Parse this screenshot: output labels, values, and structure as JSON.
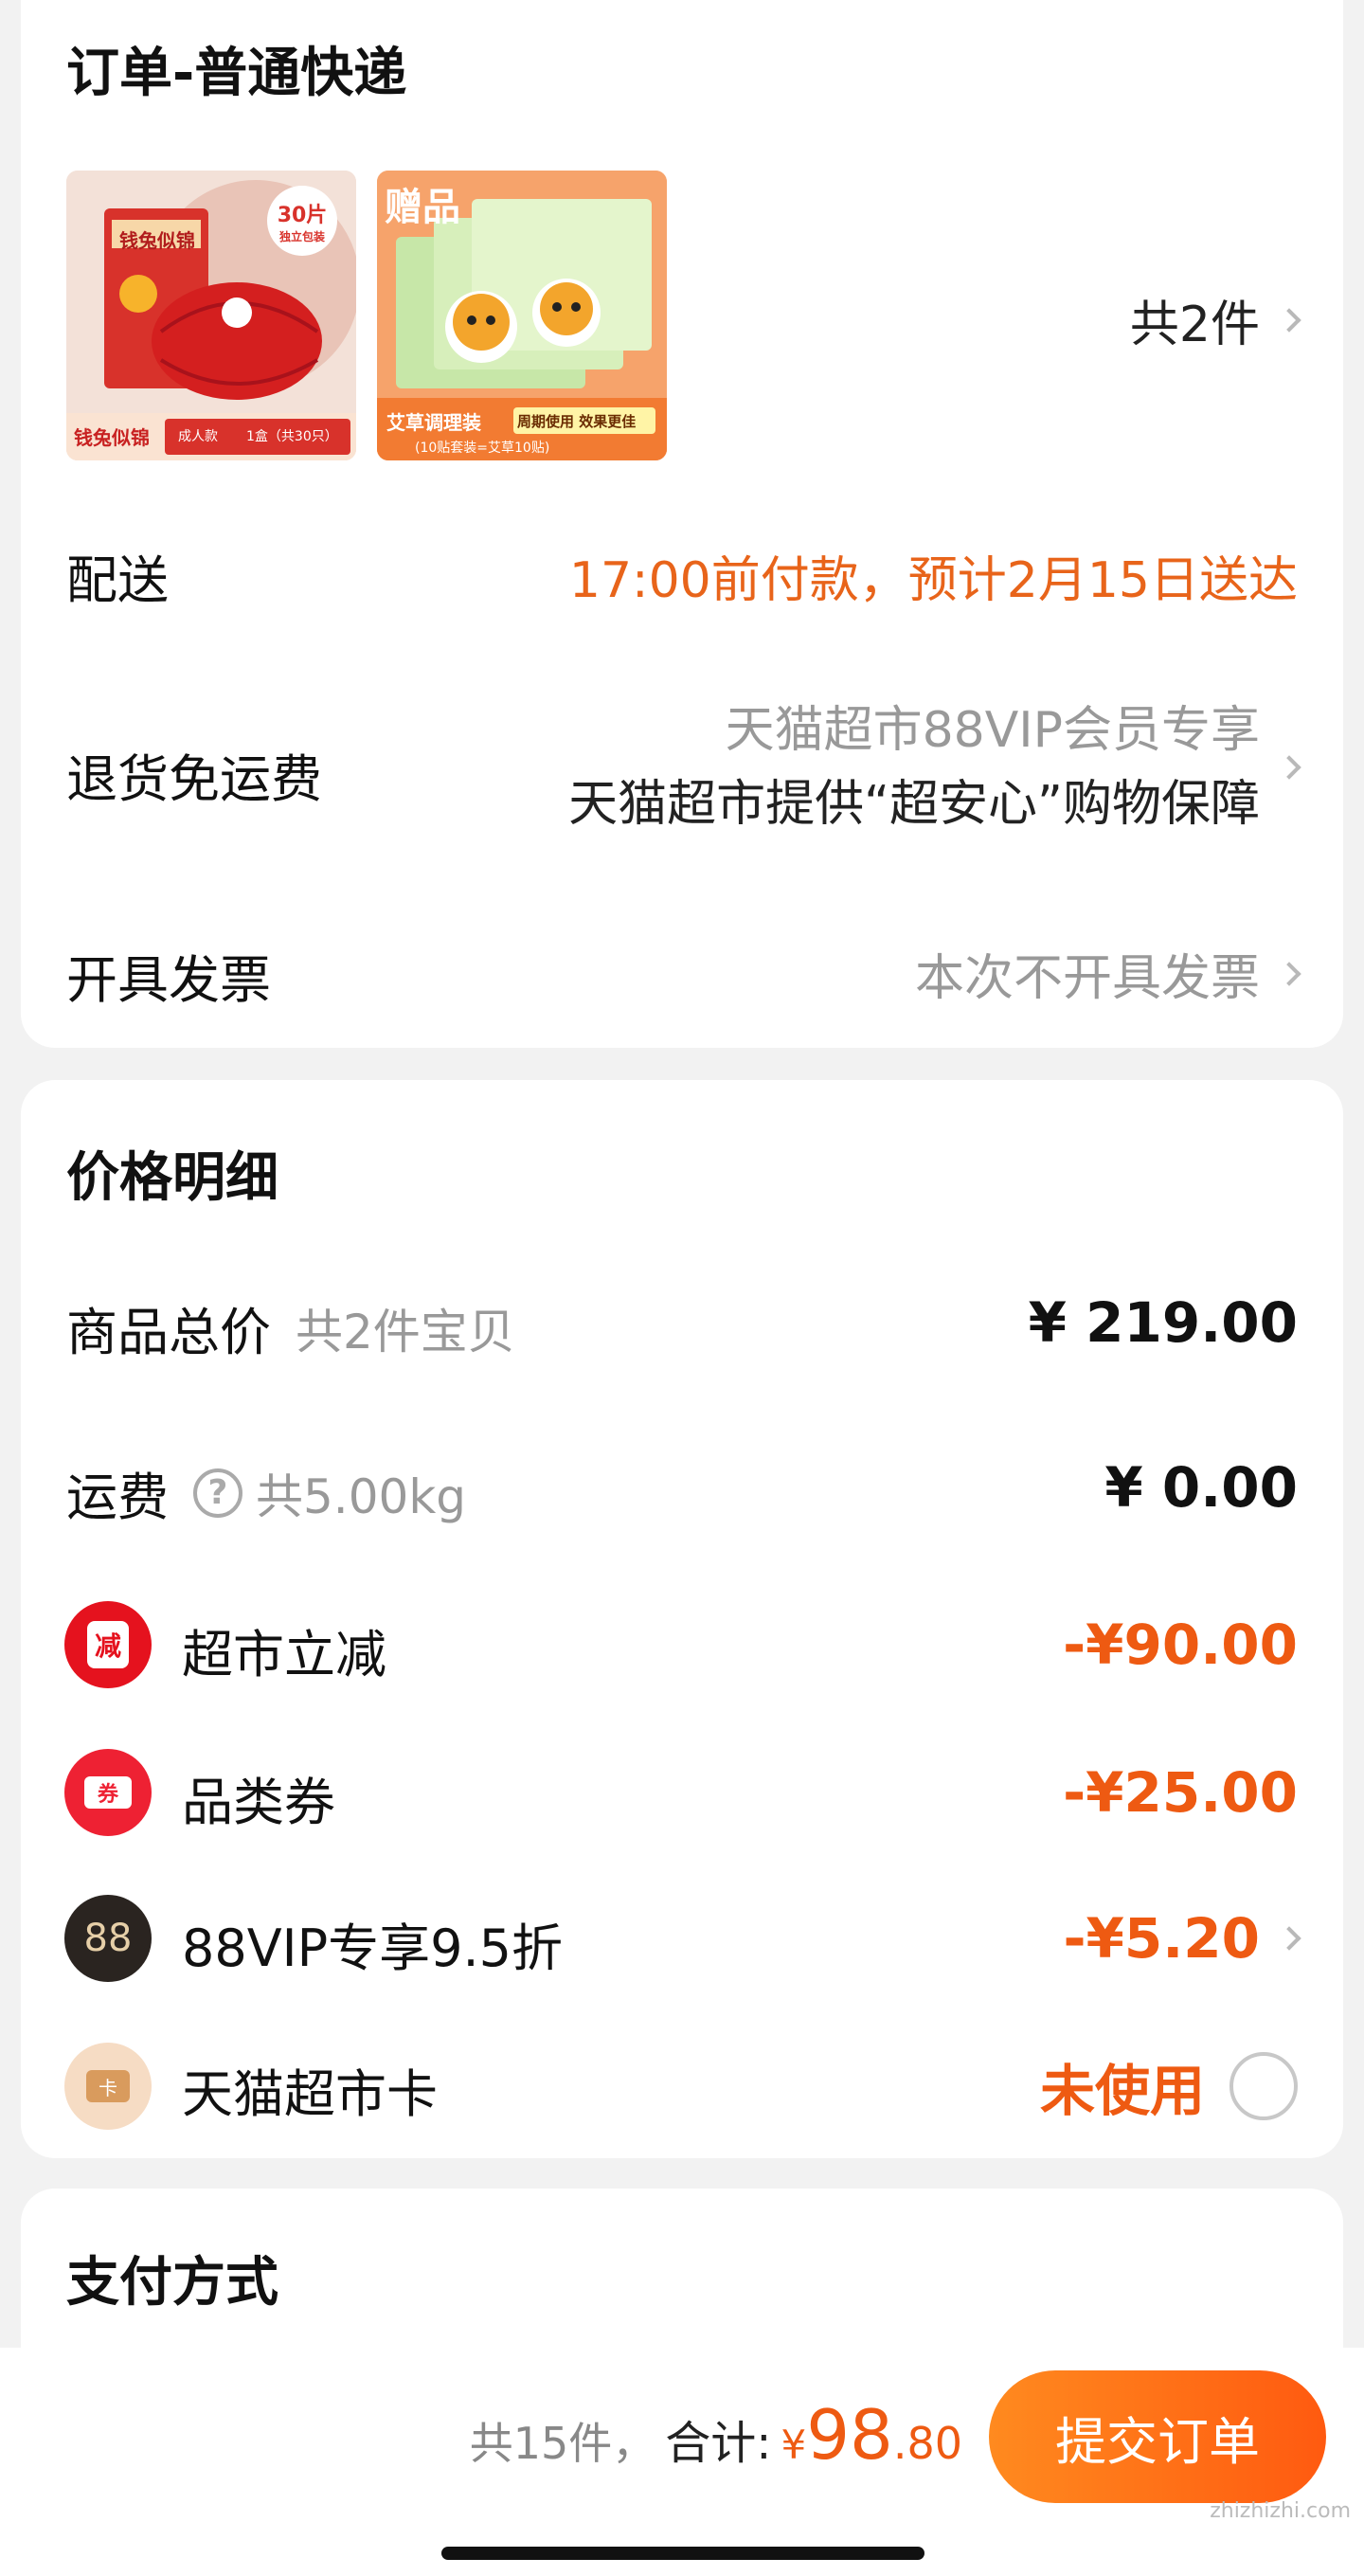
{
  "order": {
    "title": "订单-普通快递",
    "items_count": "共2件",
    "product1": {
      "brand": "钱兔似锦",
      "badge": "30片",
      "badge_sub": "独立包装",
      "caption1": "成人款",
      "caption2": "1盒（共30只）"
    },
    "product2": {
      "tag": "赠品",
      "caption": "艾草调理装",
      "caption_tag": "周期使用 效果更佳",
      "caption_sub": "(10贴套装=艾草10贴)"
    },
    "delivery_label": "配送",
    "delivery_value": "17:00前付款，预计2月15日送达",
    "return_label": "退货免运费",
    "return_line1": "天猫超市88VIP会员专享",
    "return_line2": "天猫超市提供“超安心”购物保障",
    "invoice_label": "开具发票",
    "invoice_value": "本次不开具发票"
  },
  "price": {
    "title": "价格明细",
    "goods_label": "商品总价",
    "goods_sub": "共2件宝贝",
    "goods_value": "¥ 219.00",
    "shipping_label": "运费",
    "shipping_help": "?",
    "shipping_sub": "共5.00kg",
    "shipping_value": "¥ 0.00",
    "discounts": [
      {
        "icon": "减",
        "label": "超市立减",
        "value": "-¥90.00"
      },
      {
        "icon": "券",
        "label": "品类券",
        "value": "-¥25.00"
      },
      {
        "icon": "88",
        "label": "88VIP专享9.5折",
        "value": "-¥5.20"
      },
      {
        "icon": "卡",
        "label": "天猫超市卡",
        "value": "未使用"
      }
    ]
  },
  "payment": {
    "title": "支付方式"
  },
  "footer": {
    "count": "共15件，",
    "total_label": "合计:",
    "currency": "¥",
    "total_int": "98",
    "total_dec": ".80",
    "submit": "提交订单",
    "watermark": "zhizhizhi.com"
  },
  "colors": {
    "accent": "#e8641a",
    "discount": "#ee5a12",
    "button_start": "#ff8a1f",
    "button_end": "#ff5a10"
  }
}
